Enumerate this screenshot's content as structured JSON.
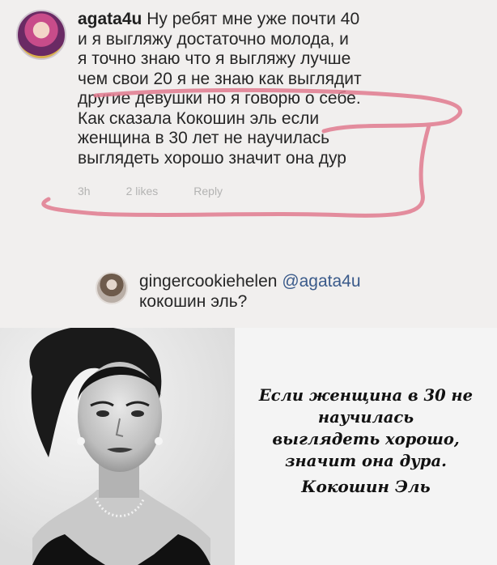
{
  "comment1": {
    "username": "agata4u",
    "text": " Ну ребят мне уже почти 40\nи я выгляжу достаточно молода, и\nя точно знаю что я выгляжу лучше\nчем свои 20 я не знаю как выглядит\nдругие девушки но я говорю о себе.\nКак сказала Кокошин эль если\nженщина в 30 лет не научилась\nвыглядеть хорошо значит она дур",
    "time": "3h",
    "likes": "2 likes",
    "reply": "Reply",
    "scribble_color": "#e07a8e"
  },
  "comment2": {
    "username": "gingercookiehelen",
    "mention": "@agata4u",
    "text": "кокошин эль?"
  },
  "poster": {
    "quote": "Если женщина в 30 не научилась\nвыглядеть хорошо,\nзначит она дура.",
    "author": "Кокошин Эль"
  }
}
